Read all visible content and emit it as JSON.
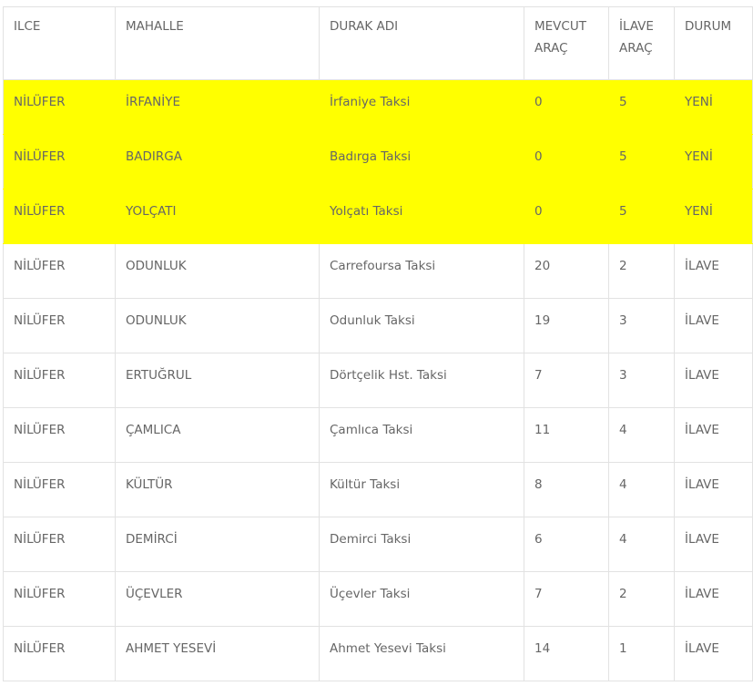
{
  "table": {
    "headers": {
      "ilce": "ILCE",
      "mahalle": "MAHALLE",
      "durak_adi": "DURAK ADI",
      "mevcut_arac": "MEVCUT ARAÇ",
      "ilave_arac": "İLAVE ARAÇ",
      "durum": "DURUM"
    },
    "highlight_color": "#ffff00",
    "rows": [
      {
        "ilce": "NİLÜFER",
        "mahalle": "İRFANİYE",
        "durak_adi": "İrfaniye Taksi",
        "mevcut_arac": "0",
        "ilave_arac": "5",
        "durum": "YENİ",
        "highlighted": true
      },
      {
        "ilce": "NİLÜFER",
        "mahalle": "BADIRGA",
        "durak_adi": "Badırga Taksi",
        "mevcut_arac": "0",
        "ilave_arac": "5",
        "durum": "YENİ",
        "highlighted": true
      },
      {
        "ilce": "NİLÜFER",
        "mahalle": "YOLÇATI",
        "durak_adi": "Yolçatı Taksi",
        "mevcut_arac": "0",
        "ilave_arac": "5",
        "durum": "YENİ",
        "highlighted": true
      },
      {
        "ilce": "NİLÜFER",
        "mahalle": "ODUNLUK",
        "durak_adi": "Carrefoursa Taksi",
        "mevcut_arac": "20",
        "ilave_arac": "2",
        "durum": "İLAVE",
        "highlighted": false
      },
      {
        "ilce": "NİLÜFER",
        "mahalle": "ODUNLUK",
        "durak_adi": "Odunluk Taksi",
        "mevcut_arac": "19",
        "ilave_arac": "3",
        "durum": "İLAVE",
        "highlighted": false
      },
      {
        "ilce": "NİLÜFER",
        "mahalle": "ERTUĞRUL",
        "durak_adi": "Dörtçelik Hst. Taksi",
        "mevcut_arac": "7",
        "ilave_arac": "3",
        "durum": "İLAVE",
        "highlighted": false
      },
      {
        "ilce": "NİLÜFER",
        "mahalle": "ÇAMLICA",
        "durak_adi": "Çamlıca Taksi",
        "mevcut_arac": "11",
        "ilave_arac": "4",
        "durum": "İLAVE",
        "highlighted": false
      },
      {
        "ilce": "NİLÜFER",
        "mahalle": "KÜLTÜR",
        "durak_adi": "Kültür Taksi",
        "mevcut_arac": "8",
        "ilave_arac": "4",
        "durum": "İLAVE",
        "highlighted": false
      },
      {
        "ilce": "NİLÜFER",
        "mahalle": "DEMİRCİ",
        "durak_adi": "Demirci Taksi",
        "mevcut_arac": "6",
        "ilave_arac": "4",
        "durum": "İLAVE",
        "highlighted": false
      },
      {
        "ilce": "NİLÜFER",
        "mahalle": "ÜÇEVLER",
        "durak_adi": "Üçevler Taksi",
        "mevcut_arac": "7",
        "ilave_arac": "2",
        "durum": "İLAVE",
        "highlighted": false
      },
      {
        "ilce": "NİLÜFER",
        "mahalle": "AHMET YESEVİ",
        "durak_adi": "Ahmet Yesevi Taksi",
        "mevcut_arac": "14",
        "ilave_arac": "1",
        "durum": "İLAVE",
        "highlighted": false
      }
    ]
  }
}
